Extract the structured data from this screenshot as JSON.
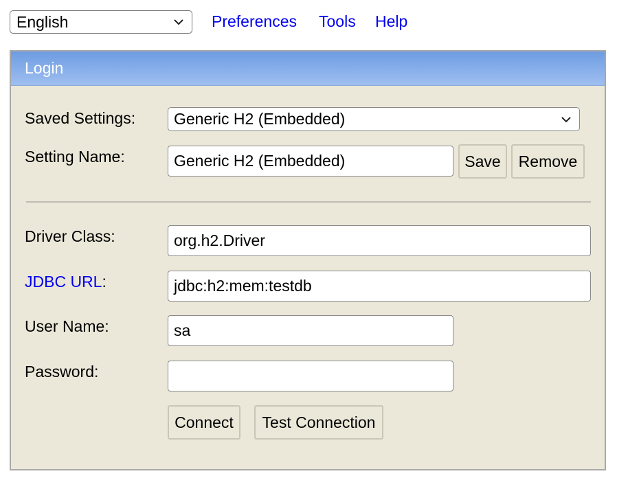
{
  "top": {
    "language": "English",
    "links": [
      "Preferences",
      "Tools",
      "Help"
    ]
  },
  "login": {
    "title": "Login",
    "saved_settings_label": "Saved Settings:",
    "saved_settings_value": "Generic H2 (Embedded)",
    "setting_name_label": "Setting Name:",
    "setting_name_value": "Generic H2 (Embedded)",
    "save_label": "Save",
    "remove_label": "Remove",
    "driver_class_label": "Driver Class:",
    "driver_class_value": "org.h2.Driver",
    "jdbc_url_label": "JDBC URL",
    "jdbc_url_colon": ":",
    "jdbc_url_value": "jdbc:h2:mem:testdb",
    "user_name_label": "User Name:",
    "user_name_value": "sa",
    "password_label": "Password:",
    "password_value": "",
    "connect_label": "Connect",
    "test_connection_label": "Test Connection"
  },
  "icons": {
    "dropdown": "chevron-down-icon"
  }
}
